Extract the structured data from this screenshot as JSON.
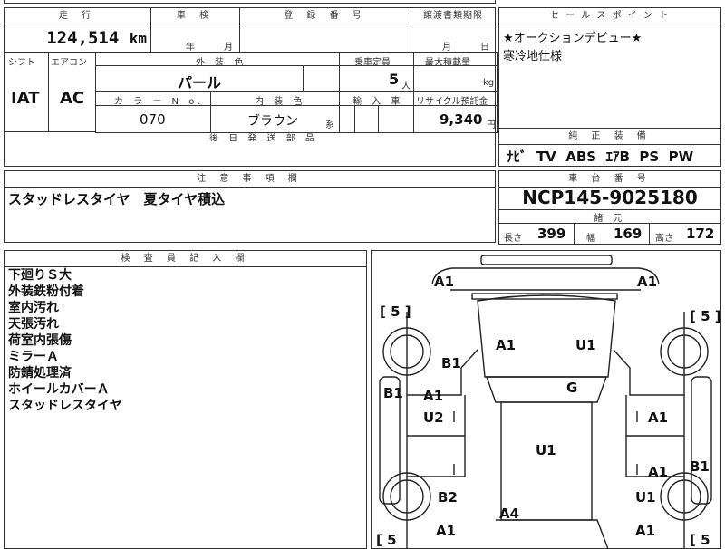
{
  "top_left_stub": "",
  "mileage": {
    "header": "走 行",
    "value": "124,514",
    "unit": "km"
  },
  "inspection": {
    "header": "車 検",
    "year_label": "年",
    "month_label": "月"
  },
  "registration": {
    "header": "登 録 番 号"
  },
  "transfer": {
    "header": "譲渡書類期限",
    "month_label": "月",
    "day_label": "日"
  },
  "sales_point": {
    "header": "セ ー ル ス ポ イ ン ト",
    "lines": [
      "★オークションデビュー★",
      "寒冷地仕様"
    ]
  },
  "shift": {
    "header": "シフト",
    "value": "IAT"
  },
  "aircon": {
    "header": "エアコン",
    "value": "AC"
  },
  "exterior": {
    "header": "外 装 色",
    "value": "パール"
  },
  "capacity": {
    "header": "乗車定員",
    "value": "5",
    "unit": "人"
  },
  "max_load": {
    "header": "最大積載量",
    "unit": "kg"
  },
  "color_no": {
    "header": "カ ラ ー N o.",
    "value": "070"
  },
  "interior": {
    "header": "内 装 色",
    "value": "ブラウン",
    "unit": "系"
  },
  "import": {
    "header": "輸 入 車"
  },
  "recycle": {
    "header": "リサイクル預託金",
    "value": "9,340",
    "unit": "円"
  },
  "later_parts": {
    "header": "後 日 発 送 部 品"
  },
  "standard_equipment": {
    "header": "純 正 装 備",
    "value": "ﾅﾋﾞ  TV  ABS  ｴｱB  PS  PW"
  },
  "cautions": {
    "header": "注 意 事 項 欄",
    "value": "スタッドレスタイヤ　夏タイヤ積込"
  },
  "chassis": {
    "header": "車 台 番 号",
    "value": "NCP145-9025180"
  },
  "specs": {
    "header": "諸 元",
    "length_label": "長さ",
    "length": "399",
    "width_label": "幅",
    "width": "169",
    "height_label": "高さ",
    "height": "172"
  },
  "inspector": {
    "header": "検 査 員 記 入 欄",
    "lines": [
      "下廻りＳ大",
      "外装鉄粉付着",
      "室内汚れ",
      "天張汚れ",
      "荷室内張傷",
      "ミラーＡ",
      "防錆処理済",
      "ホイールカバーＡ",
      "スタッドレスタイヤ"
    ]
  },
  "diagram": {
    "tire_left_front": "[ 5 ]",
    "tire_right_front": "[ 5 ]",
    "tire_left_rear": "[ 5",
    "tire_right_rear": "[ 5",
    "marks": {
      "front_left": "A1",
      "front_right": "A1",
      "hood_left": "A1",
      "hood_right": "U1",
      "fender_left": "B1",
      "roof": "G",
      "side_left": "B1",
      "front_door_left_1": "A1",
      "front_door_left_2": "U2",
      "front_door_right": "A1",
      "roof_mid": "U1",
      "rear_door_right": "A1",
      "side_right": "B1",
      "rear_fender_left": "B2",
      "rear_fender_right": "U1",
      "rear_center": "A4",
      "rear_left": "A1",
      "rear_right": "A1"
    }
  }
}
